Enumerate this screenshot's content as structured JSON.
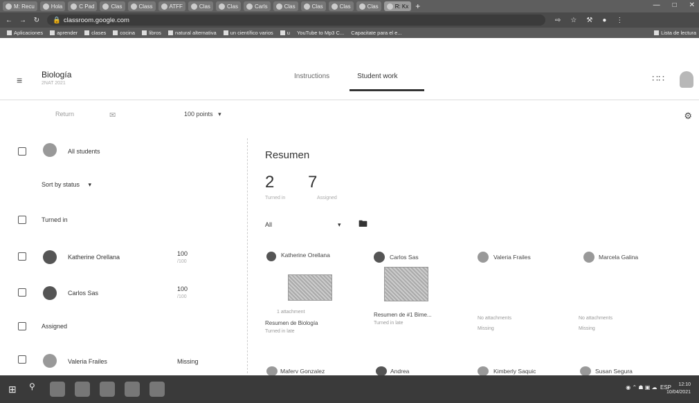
{
  "browser": {
    "tabs": [
      "M: Recu",
      "Hola",
      "C Pad",
      "Clas",
      "Class",
      "ATFF",
      "Clas",
      "Clas",
      "Carls",
      "Clas",
      "Clas",
      "Clas",
      "Clas",
      "R: Kx"
    ],
    "new_tab": "+",
    "url": "classroom.google.com",
    "bookmarks": [
      "Aplicaciones",
      "aprender",
      "clases",
      "cocina",
      "libros",
      "natural alternativa",
      "un científico varios",
      "u",
      "YouTube to Mp3 C...",
      "Capacitate para el e..."
    ],
    "bookmarks_right": "Lista de lectura"
  },
  "app": {
    "class_title": "Biología",
    "class_sub": "2NAT 2021",
    "tabs": {
      "instructions": "Instructions",
      "student_work": "Student work"
    }
  },
  "toolbar": {
    "return": "Return",
    "points": "100 points"
  },
  "left": {
    "all_students": "All students",
    "sort": "Sort by status",
    "sections": {
      "turned_in": "Turned in",
      "assigned": "Assigned"
    },
    "students": [
      {
        "name": "Katherine Orellana",
        "grade": "100",
        "sub": "/100"
      },
      {
        "name": "Carlos Sas",
        "grade": "100",
        "sub": "/100"
      },
      {
        "name": "Valeria Frailes",
        "grade": "Missing",
        "sub": ""
      }
    ]
  },
  "summary": {
    "title": "Resumen",
    "turned_in_count": "2",
    "turned_in_label": "Turned in",
    "assigned_count": "7",
    "assigned_label": "Assigned",
    "filter": "All"
  },
  "cards": [
    {
      "name": "Katherine Orellana",
      "file": "Resumen de Biología",
      "status": "Turned in late",
      "sub": "1 attachment"
    },
    {
      "name": "Carlos Sas",
      "file": "Resumen de #1 Bime...",
      "status": "Turned in late",
      "sub": ""
    },
    {
      "name": "Valeria Frailes",
      "file": "",
      "status": "Missing",
      "sub": "No attachments"
    },
    {
      "name": "Marcela Galina",
      "file": "",
      "status": "Missing",
      "sub": "No attachments"
    },
    {
      "name": "Maferv Gonzalez",
      "file": "",
      "status": "",
      "sub": ""
    },
    {
      "name": "Andrea",
      "file": "",
      "status": "",
      "sub": ""
    },
    {
      "name": "Kimberly Saquic",
      "file": "",
      "status": "",
      "sub": ""
    },
    {
      "name": "Susan Segura",
      "file": "",
      "status": "",
      "sub": ""
    }
  ],
  "taskbar": {
    "time": "12:10",
    "date": "10/04/2021",
    "lang": "ESP"
  }
}
